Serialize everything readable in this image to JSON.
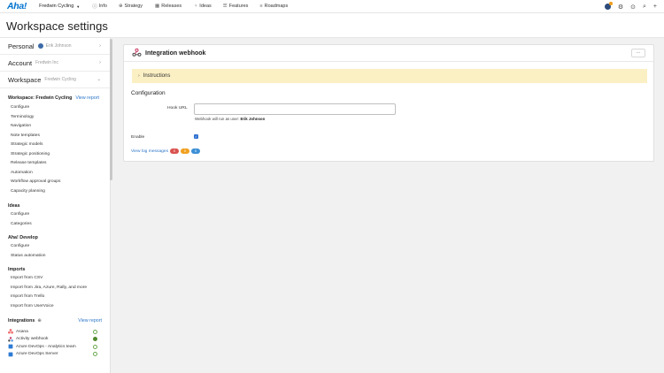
{
  "topnav": {
    "logo": "Aha!",
    "workspace_select": "Fredwin Cycling",
    "items": [
      {
        "label": "Info",
        "icon": "info-icon"
      },
      {
        "label": "Strategy",
        "icon": "strategy-icon"
      },
      {
        "label": "Releases",
        "icon": "calendar-icon"
      },
      {
        "label": "Ideas",
        "icon": "lightbulb-icon"
      },
      {
        "label": "Features",
        "icon": "list-icon"
      },
      {
        "label": "Roadmaps",
        "icon": "roadmap-icon"
      }
    ]
  },
  "page": {
    "title": "Workspace settings"
  },
  "sidebar": {
    "sections": [
      {
        "label": "Personal",
        "sub": "Erik Johnson"
      },
      {
        "label": "Account",
        "sub": "Fredwin Inc"
      },
      {
        "label": "Workspace",
        "sub": "Fredwin Cycling"
      }
    ],
    "workspace_group": {
      "title": "Workspace: Fredwin Cycling",
      "view_report": "View report",
      "items": [
        "Configure",
        "Terminology",
        "Navigation",
        "Note templates",
        "Strategic models",
        "Strategic positioning",
        "Release templates",
        "Automation",
        "Workflow approval groups",
        "Capacity planning"
      ]
    },
    "ideas_group": {
      "title": "Ideas",
      "items": [
        "Configure",
        "Categories"
      ]
    },
    "develop_group": {
      "title": "Aha! Develop",
      "items": [
        "Configure",
        "Status automation"
      ]
    },
    "imports_group": {
      "title": "Imports",
      "items": [
        "Import from CSV",
        "Import from Jira, Azure, Rally, and more",
        "Import from Trello",
        "Import from UserVoice"
      ]
    },
    "integrations_group": {
      "title": "Integrations",
      "view_report": "View report",
      "items": [
        {
          "label": "Asana",
          "active": false
        },
        {
          "label": "Activity webhook",
          "active": true
        },
        {
          "label": "Azure DevOps - Analytics team",
          "active": false
        },
        {
          "label": "Azure DevOps Server",
          "active": false
        }
      ]
    }
  },
  "card": {
    "title": "Integration webhook",
    "more": "···",
    "instructions": "Instructions",
    "config_title": "Configuration",
    "hook_url_label": "Hook URL",
    "hook_url_value": "",
    "hook_help_prefix": "Webhook will run as user:",
    "hook_help_user": "Erik Johnson",
    "enable_label": "Enable",
    "enable_checked": true,
    "log_link": "View log messages",
    "log_counts": [
      {
        "value": "0",
        "color": "#d9534f"
      },
      {
        "value": "0",
        "color": "#f0a020"
      },
      {
        "value": "0",
        "color": "#3b8fd6"
      }
    ]
  }
}
